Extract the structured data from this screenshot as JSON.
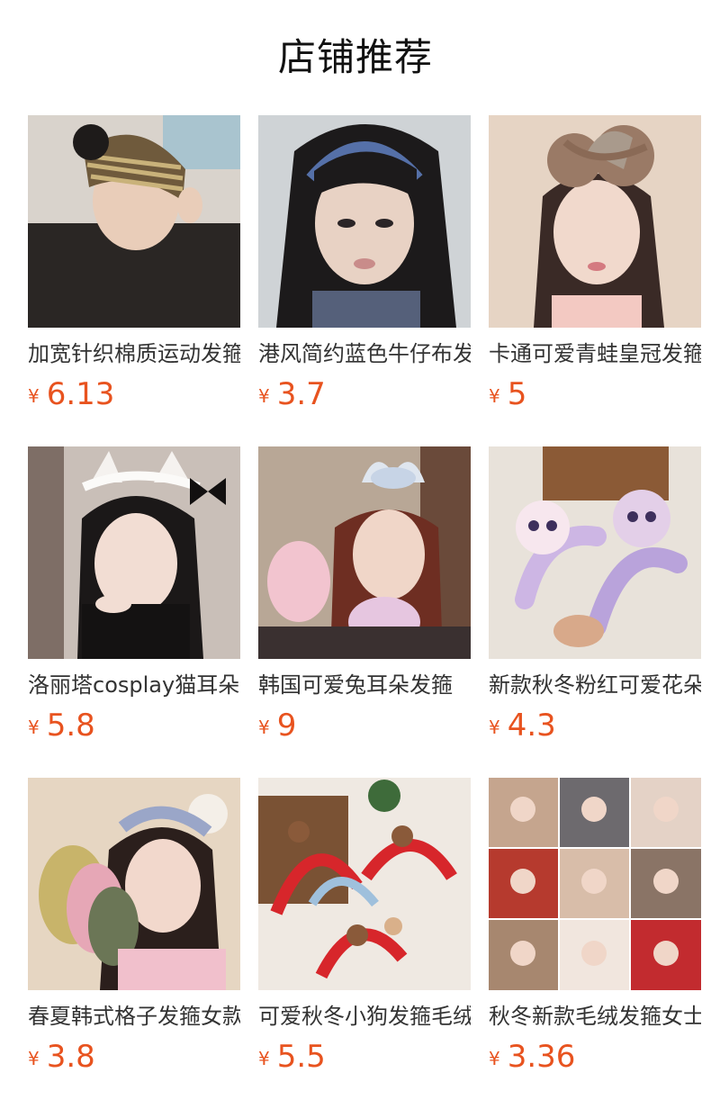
{
  "section": {
    "title": "店铺推荐"
  },
  "colors": {
    "price": "#e8531f",
    "title": "#333333",
    "heading": "#111111"
  },
  "products": [
    {
      "title": "加宽针织棉质运动发箍",
      "currency": "¥",
      "price": "6.13",
      "image_icon": "product-photo"
    },
    {
      "title": "港风简约蓝色牛仔布发箍",
      "currency": "¥",
      "price": "3.7",
      "image_icon": "product-photo"
    },
    {
      "title": "卡通可爱青蛙皇冠发箍",
      "currency": "¥",
      "price": "5",
      "image_icon": "product-photo"
    },
    {
      "title": "洛丽塔cosplay猫耳朵发箍",
      "currency": "¥",
      "price": "5.8",
      "image_icon": "product-photo"
    },
    {
      "title": "韩国可爱兔耳朵发箍",
      "currency": "¥",
      "price": "9",
      "image_icon": "product-photo"
    },
    {
      "title": "新款秋冬粉红可爱花朵发箍",
      "currency": "¥",
      "price": "4.3",
      "image_icon": "product-photo"
    },
    {
      "title": "春夏韩式格子发箍女款",
      "currency": "¥",
      "price": "3.8",
      "image_icon": "product-photo"
    },
    {
      "title": "可爱秋冬小狗发箍毛绒",
      "currency": "¥",
      "price": "5.5",
      "image_icon": "product-photo"
    },
    {
      "title": "秋冬新款毛绒发箍女士",
      "currency": "¥",
      "price": "3.36",
      "image_icon": "product-photo"
    }
  ]
}
